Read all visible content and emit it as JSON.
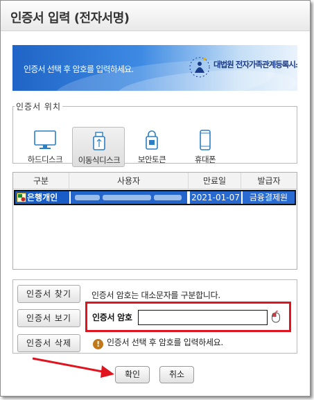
{
  "window": {
    "title": "인증서 입력 (전자서명)"
  },
  "banner": {
    "instruction": "인증서 선택 후 암호를 입력하세요.",
    "org": "대법원 전자가족관계등록시스템"
  },
  "location": {
    "legend": "인증서 위치",
    "options": [
      {
        "label": "하드디스크",
        "icon": "monitor-icon",
        "selected": false
      },
      {
        "label": "이동식디스크",
        "icon": "usb-icon",
        "selected": true
      },
      {
        "label": "보안토큰",
        "icon": "security-token-icon",
        "selected": false
      },
      {
        "label": "휴대폰",
        "icon": "phone-icon",
        "selected": false
      }
    ]
  },
  "table": {
    "columns": [
      "구분",
      "사용자",
      "만료일",
      "발급자"
    ],
    "rows": [
      {
        "type": "은행개인",
        "user": "",
        "expiry": "2021-01-07",
        "issuer": "금융결제원",
        "selected": true
      }
    ]
  },
  "buttons": {
    "find": "인증서 찾기",
    "view": "인증서 보기",
    "delete": "인증서 삭제",
    "confirm": "확인",
    "cancel": "취소"
  },
  "password": {
    "hint": "인증서 암호는 대소문자를 구분합니다.",
    "label": "인증서 암호",
    "value": "",
    "warning": "인증서 선택 후 암호를 입력하세요."
  },
  "colors": {
    "accent": "#1a5cc6",
    "highlight": "#e0141e",
    "warning": "#c07818"
  }
}
